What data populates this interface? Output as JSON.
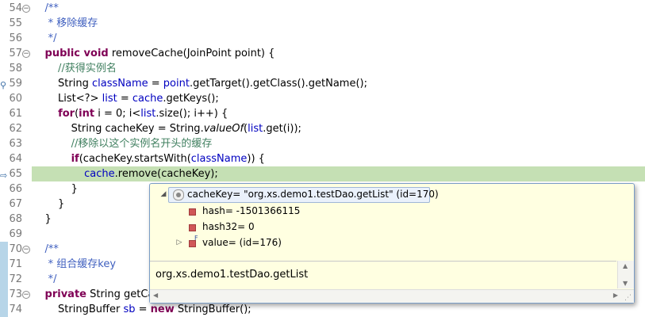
{
  "editor": {
    "lines": [
      {
        "num": "54",
        "fold": "⊖",
        "tokens": [
          {
            "t": "    /**",
            "c": "jd"
          }
        ]
      },
      {
        "num": "55",
        "tokens": [
          {
            "t": "     * 移除缓存",
            "c": "jd"
          }
        ]
      },
      {
        "num": "56",
        "tokens": [
          {
            "t": "     */",
            "c": "jd"
          }
        ]
      },
      {
        "num": "57",
        "fold": "⊖",
        "tokens": [
          {
            "t": "    ",
            "c": ""
          },
          {
            "t": "public void",
            "c": "kw"
          },
          {
            "t": " removeCache(JoinPoint point) {",
            "c": ""
          }
        ]
      },
      {
        "num": "58",
        "tokens": [
          {
            "t": "        //获得实例名",
            "c": "cm"
          }
        ]
      },
      {
        "num": "59",
        "marker": "⚲",
        "tokens": [
          {
            "t": "        String ",
            "c": ""
          },
          {
            "t": "className",
            "c": "fld"
          },
          {
            "t": " = ",
            "c": ""
          },
          {
            "t": "point",
            "c": "fld"
          },
          {
            "t": ".getTarget().getClass().getName();",
            "c": ""
          }
        ]
      },
      {
        "num": "60",
        "tokens": [
          {
            "t": "        List<?> ",
            "c": ""
          },
          {
            "t": "list",
            "c": "fld"
          },
          {
            "t": " = ",
            "c": ""
          },
          {
            "t": "cache",
            "c": "fld"
          },
          {
            "t": ".getKeys();",
            "c": ""
          }
        ]
      },
      {
        "num": "61",
        "tokens": [
          {
            "t": "        ",
            "c": ""
          },
          {
            "t": "for",
            "c": "kw"
          },
          {
            "t": "(",
            "c": ""
          },
          {
            "t": "int",
            "c": "kw"
          },
          {
            "t": " i = 0; i<",
            "c": ""
          },
          {
            "t": "list",
            "c": "fld"
          },
          {
            "t": ".size(); i++) {",
            "c": ""
          }
        ]
      },
      {
        "num": "62",
        "tokens": [
          {
            "t": "            String ",
            "c": ""
          },
          {
            "t": "cacheKey",
            "c": ""
          },
          {
            "t": " = String.",
            "c": ""
          },
          {
            "t": "valueOf",
            "c": "it"
          },
          {
            "t": "(",
            "c": ""
          },
          {
            "t": "list",
            "c": "fld"
          },
          {
            "t": ".get(i));",
            "c": ""
          }
        ]
      },
      {
        "num": "63",
        "tokens": [
          {
            "t": "            //移除以这个实例名开头的缓存",
            "c": "cm"
          }
        ]
      },
      {
        "num": "64",
        "tokens": [
          {
            "t": "            ",
            "c": ""
          },
          {
            "t": "if",
            "c": "kw"
          },
          {
            "t": "(cacheKey.startsWith(",
            "c": ""
          },
          {
            "t": "className",
            "c": "fld"
          },
          {
            "t": ")) {",
            "c": ""
          }
        ]
      },
      {
        "num": "65",
        "marker": "⇨",
        "highlight": true,
        "tokens": [
          {
            "t": "                ",
            "c": ""
          },
          {
            "t": "cache",
            "c": "fld"
          },
          {
            "t": ".remove(",
            "c": ""
          },
          {
            "t": "cacheKey",
            "c": ""
          },
          {
            "t": ");",
            "c": ""
          }
        ]
      },
      {
        "num": "66",
        "tokens": [
          {
            "t": "            }",
            "c": ""
          }
        ]
      },
      {
        "num": "67",
        "tokens": [
          {
            "t": "        }",
            "c": ""
          }
        ]
      },
      {
        "num": "68",
        "tokens": [
          {
            "t": "    }",
            "c": ""
          }
        ]
      },
      {
        "num": "69",
        "tokens": [
          {
            "t": "",
            "c": ""
          }
        ]
      },
      {
        "num": "70",
        "fold": "⊖",
        "bar": true,
        "tokens": [
          {
            "t": "    /**",
            "c": "jd"
          }
        ]
      },
      {
        "num": "71",
        "bar": true,
        "tokens": [
          {
            "t": "     * 组合缓存key",
            "c": "jd"
          }
        ]
      },
      {
        "num": "72",
        "bar": true,
        "tokens": [
          {
            "t": "     */",
            "c": "jd"
          }
        ]
      },
      {
        "num": "73",
        "fold": "⊖",
        "bar": true,
        "tokens": [
          {
            "t": "    ",
            "c": ""
          },
          {
            "t": "private",
            "c": "kw"
          },
          {
            "t": " String getCa",
            "c": ""
          }
        ]
      },
      {
        "num": "74",
        "bar": true,
        "tokens": [
          {
            "t": "        StringBuffer ",
            "c": ""
          },
          {
            "t": "sb",
            "c": "fld"
          },
          {
            "t": " = ",
            "c": ""
          },
          {
            "t": "new",
            "c": "kw"
          },
          {
            "t": " StringBuffer();",
            "c": ""
          }
        ]
      }
    ]
  },
  "popup": {
    "root": {
      "twisty": "◢",
      "label": "cacheKey= \"org.xs.demo1.testDao.getList\" (id=170)"
    },
    "children": [
      {
        "icon": "field-icon",
        "label": "hash= -1501366115",
        "expandable": false
      },
      {
        "icon": "field-icon",
        "label": "hash32= 0",
        "expandable": false
      },
      {
        "icon": "final-field-icon",
        "label": "value= (id=176)",
        "expandable": true,
        "twisty": "▷",
        "badge": "F"
      }
    ],
    "detail_text": "org.xs.demo1.testDao.getList"
  }
}
